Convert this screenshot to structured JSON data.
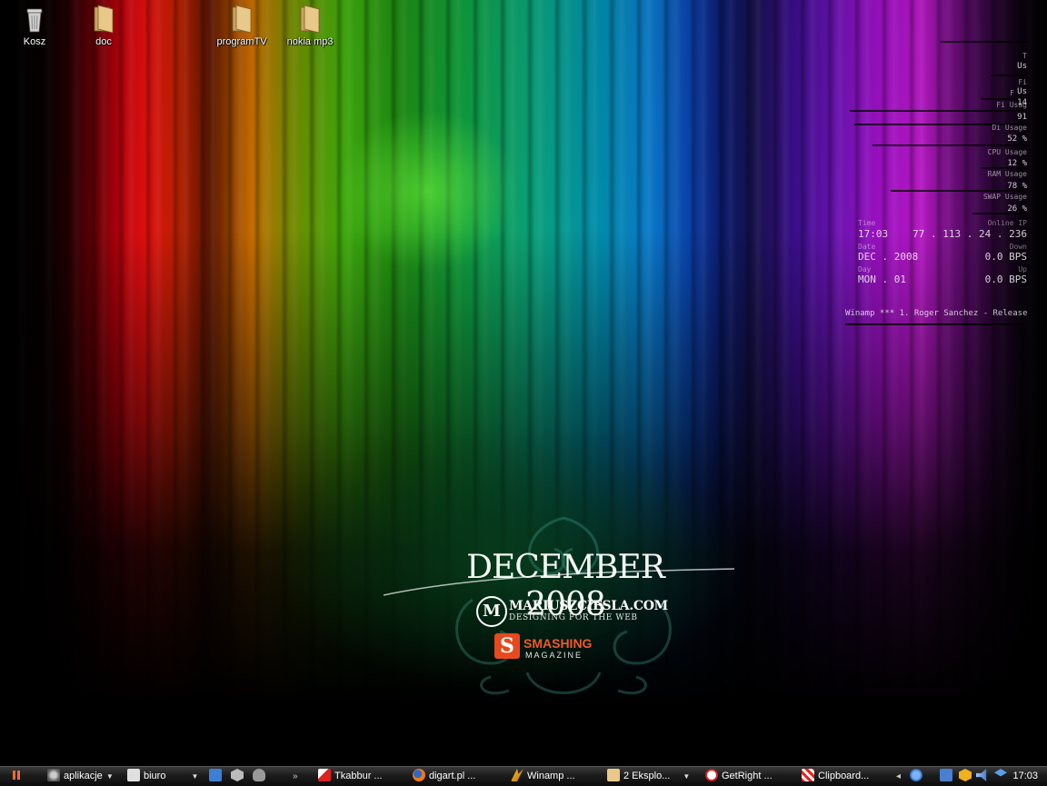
{
  "desktop_icons": [
    {
      "label": "Kosz",
      "icon": "trash-icon"
    },
    {
      "label": "doc",
      "icon": "folder-icon"
    },
    {
      "label": "programTV",
      "icon": "folder-icon"
    },
    {
      "label": "nokia mp3",
      "icon": "folder-icon"
    }
  ],
  "wallpaper": {
    "month": "DECEMBER 2008",
    "site_name": "MARIUSZCIESLA.COM",
    "site_tagline": "DESIGNING FOR THE WEB",
    "site_logo_letter": "M",
    "magazine_logo_letter": "S",
    "magazine_name": "SMASHING",
    "magazine_sub": "MAGAZINE"
  },
  "system_monitor": {
    "stats": [
      {
        "label": "T",
        "value": "Us"
      },
      {
        "label": "Fi",
        "value": "Us"
      },
      {
        "label": "F",
        "value": "14"
      },
      {
        "label": "Fi   Usag",
        "value": "91"
      },
      {
        "label": "Di    Usage",
        "value": "52 %"
      },
      {
        "label": "CPU Usage",
        "value": "12 %"
      },
      {
        "label": "RAM Usage",
        "value": "78 %"
      },
      {
        "label": "SWAP Usage",
        "value": "26 %"
      }
    ],
    "time_label": "Time",
    "time": "17:03",
    "ip_label": "Online IP",
    "ip": "77 . 113 . 24 . 236",
    "date_label": "Date",
    "date": "DEC . 2008",
    "down_label": "Down",
    "down": "0.0 BPS",
    "day_label": "Day",
    "day": "MON . 01",
    "up_label": "Up",
    "up": "0.0 BPS",
    "now_playing": "Winamp *** 1. Roger Sanchez - Release"
  },
  "taskbar": {
    "start_icon": "pause-icon",
    "menu_aplikacje": "aplikacje",
    "menu_biuro": "biuro",
    "overflow": "»",
    "tasks": [
      {
        "label": "Tkabbur ...",
        "icon": "tkabber-icon"
      },
      {
        "label": "digart.pl ...",
        "icon": "firefox-icon"
      },
      {
        "label": "Winamp ...",
        "icon": "winamp-icon"
      },
      {
        "label": "2 Eksplo...",
        "icon": "folder-icon"
      },
      {
        "label": "GetRight ...",
        "icon": "getright-icon"
      },
      {
        "label": "Clipboard...",
        "icon": "clipboard-icon"
      }
    ],
    "tray_arrow": "◂",
    "clock": "17:03"
  },
  "colors": {
    "taskbar_top": "#3a3a3a",
    "taskbar_bottom": "#0c0c0c",
    "magazine_accent": "#e8491d",
    "folder": "#e9c98a"
  }
}
